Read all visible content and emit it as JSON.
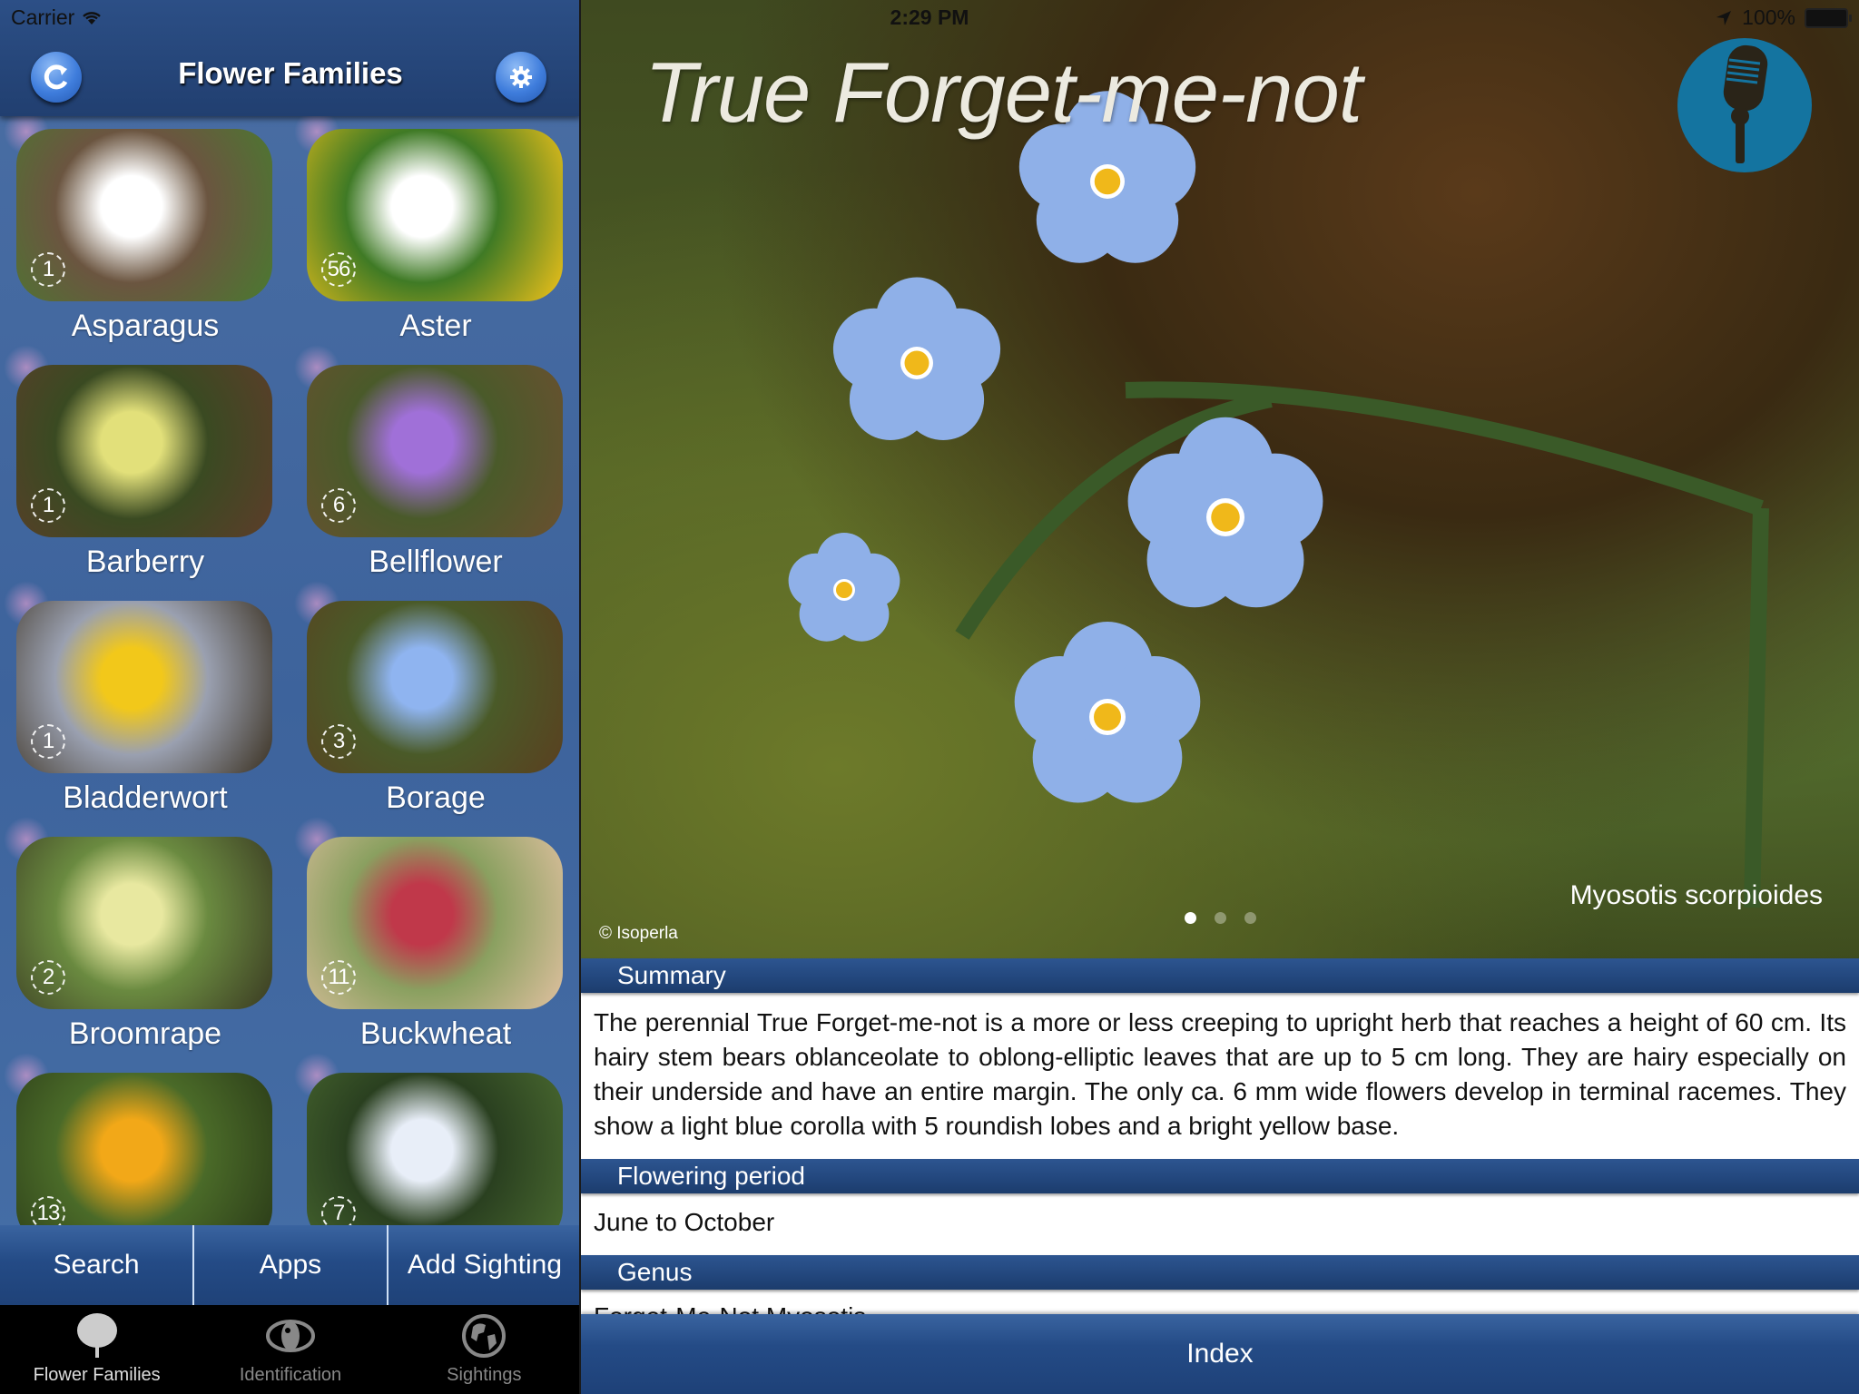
{
  "status_bar": {
    "carrier": "Carrier",
    "time": "2:29 PM",
    "battery": "100%"
  },
  "left_panel": {
    "title": "Flower Families",
    "families": [
      {
        "name": "Asparagus",
        "count": "1",
        "colors": [
          "#6b5540",
          "#ffffff",
          "#4a7a30"
        ]
      },
      {
        "name": "Aster",
        "count": "56",
        "colors": [
          "#3f7a25",
          "#ffffff",
          "#f2c21a"
        ]
      },
      {
        "name": "Barberry",
        "count": "1",
        "colors": [
          "#3a4a22",
          "#e2e07a",
          "#5d3d2a"
        ]
      },
      {
        "name": "Bellflower",
        "count": "6",
        "colors": [
          "#4a5a2a",
          "#a070d8",
          "#6a5030"
        ]
      },
      {
        "name": "Bladderwort",
        "count": "1",
        "colors": [
          "#9aa0b0",
          "#f2c81a",
          "#3a3020"
        ]
      },
      {
        "name": "Borage",
        "count": "3",
        "colors": [
          "#4a5a28",
          "#8fb4f0",
          "#5a4020"
        ]
      },
      {
        "name": "Broomrape",
        "count": "2",
        "colors": [
          "#6a8a40",
          "#e8e8a0",
          "#3a3a22"
        ]
      },
      {
        "name": "Buckwheat",
        "count": "11",
        "colors": [
          "#8aa060",
          "#c0384a",
          "#e0c0a0"
        ]
      },
      {
        "name": "",
        "count": "13",
        "colors": [
          "#4a6a28",
          "#f2a818",
          "#2a3a18"
        ]
      },
      {
        "name": "",
        "count": "7",
        "colors": [
          "#2a4020",
          "#e8eef8",
          "#4a6a30"
        ]
      }
    ],
    "buttons": [
      "Search",
      "Apps",
      "Add Sighting"
    ],
    "tabs": [
      {
        "label": "Flower Families",
        "icon": "tree-icon",
        "active": true
      },
      {
        "label": "Identification",
        "icon": "eye-icon",
        "active": false
      },
      {
        "label": "Sightings",
        "icon": "globe-icon",
        "active": false
      }
    ]
  },
  "detail": {
    "common_name": "True Forget-me-not",
    "scientific_name": "Myosotis scorpioides",
    "photo_credit": "© Isoperla",
    "photo_page": 1,
    "photo_pages": 3,
    "sections": [
      {
        "heading": "Summary",
        "text": "The perennial True Forget-me-not is a more or less creeping to upright herb that reaches a height of 60 cm. Its hairy stem bears oblanceolate to oblong-elliptic leaves that are up to 5 cm long. They are hairy especially on their underside and have an entire margin. The only ca. 6 mm wide flowers develop in terminal racemes. They show a light blue corolla with 5 roundish lobes and a bright yellow base."
      },
      {
        "heading": "Flowering period",
        "text": "June to October"
      },
      {
        "heading": "Genus",
        "text": "Forget-Me-Not Myosotis"
      }
    ],
    "index_label": "Index"
  },
  "colors": {
    "nav_blue": "#22467c",
    "mic_blue": "#1474a0",
    "petal_blue": "#8fb0e8",
    "flower_center": "#f0b81a"
  }
}
